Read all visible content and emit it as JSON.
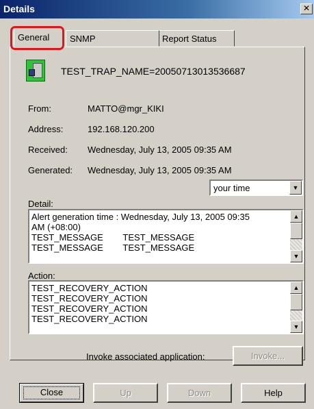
{
  "window": {
    "title": "Details",
    "close_glyph": "✕"
  },
  "tabs": [
    {
      "label": "General",
      "active": true
    },
    {
      "label": "SNMP",
      "active": false
    },
    {
      "label": "Report Status",
      "active": false
    }
  ],
  "highlight_color": "#e0161b",
  "header": {
    "icon": "server-alert-icon",
    "trap_name": "TEST_TRAP_NAME=20050713013536687"
  },
  "fields": [
    {
      "label": "From:",
      "value": "MATTO@mgr_KIKI"
    },
    {
      "label": "Address:",
      "value": "192.168.120.200"
    },
    {
      "label": "Received:",
      "value": "Wednesday, July 13, 2005 09:35 AM"
    },
    {
      "label": "Generated:",
      "value": "Wednesday, July 13, 2005 09:35 AM"
    }
  ],
  "time_select": {
    "value": "your time"
  },
  "detail": {
    "label": "Detail:",
    "lines": [
      "Alert generation time : Wednesday, July 13, 2005 09:35",
      "AM (+08:00)",
      "TEST_MESSAGE        TEST_MESSAGE",
      "TEST_MESSAGE        TEST_MESSAGE"
    ]
  },
  "action": {
    "label": "Action:",
    "lines": [
      "TEST_RECOVERY_ACTION",
      "TEST_RECOVERY_ACTION",
      "TEST_RECOVERY_ACTION",
      "TEST_RECOVERY_ACTION"
    ]
  },
  "invoke": {
    "label": "Invoke associated application:",
    "button": "Invoke..."
  },
  "footer": {
    "close": "Close",
    "up": "Up",
    "down": "Down",
    "help": "Help"
  }
}
